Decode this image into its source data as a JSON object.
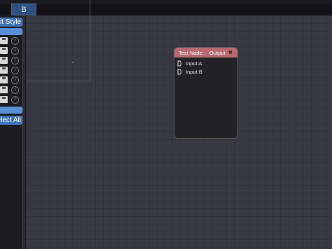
{
  "topbar": {
    "tab_label": "B"
  },
  "sidebar": {
    "edit_style_label": "Edit Style",
    "select_all_label": "Select All",
    "rows": 7
  },
  "node": {
    "title": "Test Node",
    "output_label": "Output",
    "close_glyph": "✖",
    "inputs": [
      "Input A",
      "Input B"
    ]
  },
  "colors": {
    "accent": "#3f73b8",
    "node_header": "#b86a70",
    "canvas": "#393943"
  }
}
